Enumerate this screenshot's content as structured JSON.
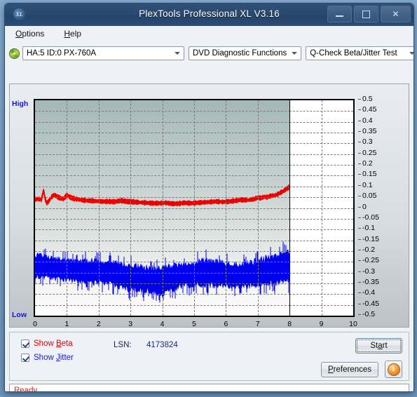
{
  "window": {
    "title": "PlexTools Professional XL V3.16",
    "app_icon": "XL",
    "minimize": "minimize-icon",
    "maximize": "maximize-icon",
    "close": "close-icon"
  },
  "menubar": {
    "items": [
      {
        "label": "Options",
        "mnemonic": "O"
      },
      {
        "label": "Help",
        "mnemonic": "H"
      }
    ]
  },
  "toolbar": {
    "drive_icon": "disc-icon",
    "drive": "HA:5 ID:0  PX-760A",
    "function": "DVD Diagnostic Functions",
    "test": "Q-Check Beta/Jitter Test"
  },
  "controls": {
    "show_beta": {
      "label_pre": "Show ",
      "label_mnemonic": "B",
      "label_post": "eta",
      "checked": true,
      "color": "#e00000"
    },
    "show_jitter": {
      "label_pre": "Show ",
      "label_mnemonic": "J",
      "label_post": "itter",
      "checked": true,
      "color": "#1616d8"
    },
    "lsn_label": "LSN:",
    "lsn_value": "4173824",
    "start": {
      "pre": "St",
      "mnemonic": "a",
      "post": "rt"
    },
    "preferences": {
      "pre": "",
      "mnemonic": "P",
      "post": "references"
    },
    "info": "i"
  },
  "status": {
    "text": "Ready"
  },
  "chart_data": {
    "type": "line",
    "title": "Q-Check Beta/Jitter Test",
    "xlabel": "",
    "ylabel": "",
    "xlim": [
      0,
      10
    ],
    "ylim": [
      -0.5,
      0.5
    ],
    "grid": true,
    "axis_high_label": "High",
    "axis_low_label": "Low",
    "xticks": [
      0,
      1,
      2,
      3,
      4,
      5,
      6,
      7,
      8,
      9,
      10
    ],
    "yticks": [
      0.5,
      0.45,
      0.4,
      0.35,
      0.3,
      0.25,
      0.2,
      0.15,
      0.1,
      0.05,
      0,
      -0.05,
      -0.1,
      -0.15,
      -0.2,
      -0.25,
      -0.3,
      -0.35,
      -0.4,
      -0.45,
      -0.5
    ],
    "cursor_x": 8.0,
    "data_end_x": 8.0,
    "legend_position": "none",
    "series": [
      {
        "name": "Beta",
        "color": "#ee0000",
        "type": "line",
        "x": [
          0.0,
          0.1,
          0.2,
          0.27,
          0.3,
          0.36,
          0.42,
          0.5,
          0.6,
          0.7,
          0.8,
          0.9,
          1.0,
          1.1,
          1.2,
          1.35,
          1.5,
          1.7,
          1.9,
          2.1,
          2.3,
          2.5,
          2.7,
          2.9,
          3.1,
          3.3,
          3.5,
          3.7,
          3.9,
          4.1,
          4.3,
          4.5,
          4.7,
          4.9,
          5.1,
          5.3,
          5.5,
          5.7,
          5.9,
          6.1,
          6.3,
          6.5,
          6.7,
          6.9,
          7.0,
          7.1,
          7.2,
          7.3,
          7.4,
          7.5,
          7.6,
          7.7,
          7.8,
          7.9,
          8.0
        ],
        "y": [
          0.04,
          0.042,
          0.038,
          0.085,
          0.055,
          0.022,
          0.03,
          0.048,
          0.062,
          0.052,
          0.045,
          0.042,
          0.06,
          0.05,
          0.044,
          0.04,
          0.036,
          0.034,
          0.032,
          0.03,
          0.03,
          0.029,
          0.034,
          0.03,
          0.028,
          0.026,
          0.024,
          0.022,
          0.022,
          0.024,
          0.02,
          0.02,
          0.024,
          0.022,
          0.024,
          0.026,
          0.028,
          0.03,
          0.028,
          0.03,
          0.034,
          0.038,
          0.036,
          0.042,
          0.048,
          0.046,
          0.052,
          0.05,
          0.056,
          0.058,
          0.062,
          0.07,
          0.078,
          0.088,
          0.098
        ],
        "band_half": 0.008
      },
      {
        "name": "Jitter",
        "color": "#0000ee",
        "type": "noise-band",
        "x": [
          0.0,
          0.2,
          0.4,
          0.6,
          0.8,
          1.0,
          1.2,
          1.4,
          1.6,
          1.8,
          2.0,
          2.2,
          2.4,
          2.6,
          2.8,
          3.0,
          3.2,
          3.4,
          3.6,
          3.8,
          4.0,
          4.2,
          4.4,
          4.6,
          4.8,
          5.0,
          5.2,
          5.4,
          5.6,
          5.8,
          6.0,
          6.2,
          6.4,
          6.6,
          6.8,
          7.0,
          7.2,
          7.4,
          7.6,
          7.8,
          8.0
        ],
        "y_center": [
          -0.27,
          -0.272,
          -0.276,
          -0.28,
          -0.284,
          -0.288,
          -0.292,
          -0.292,
          -0.294,
          -0.296,
          -0.298,
          -0.3,
          -0.304,
          -0.31,
          -0.318,
          -0.324,
          -0.326,
          -0.33,
          -0.332,
          -0.336,
          -0.344,
          -0.33,
          -0.322,
          -0.314,
          -0.308,
          -0.304,
          -0.302,
          -0.3,
          -0.302,
          -0.306,
          -0.308,
          -0.312,
          -0.314,
          -0.312,
          -0.306,
          -0.3,
          -0.294,
          -0.288,
          -0.282,
          -0.276,
          -0.268
        ],
        "half_width": [
          0.052,
          0.05,
          0.048,
          0.046,
          0.046,
          0.046,
          0.046,
          0.048,
          0.048,
          0.05,
          0.052,
          0.05,
          0.05,
          0.052,
          0.054,
          0.056,
          0.056,
          0.054,
          0.054,
          0.056,
          0.06,
          0.058,
          0.054,
          0.05,
          0.05,
          0.052,
          0.054,
          0.056,
          0.056,
          0.054,
          0.052,
          0.05,
          0.05,
          0.052,
          0.054,
          0.056,
          0.058,
          0.06,
          0.062,
          0.064,
          0.066
        ],
        "spike_half": [
          0.072,
          0.07,
          0.068,
          0.066,
          0.066,
          0.066,
          0.068,
          0.07,
          0.07,
          0.072,
          0.074,
          0.072,
          0.072,
          0.074,
          0.078,
          0.08,
          0.08,
          0.078,
          0.078,
          0.08,
          0.086,
          0.084,
          0.078,
          0.074,
          0.074,
          0.076,
          0.078,
          0.08,
          0.08,
          0.078,
          0.076,
          0.074,
          0.074,
          0.076,
          0.078,
          0.082,
          0.084,
          0.086,
          0.088,
          0.09,
          0.094
        ]
      }
    ]
  }
}
